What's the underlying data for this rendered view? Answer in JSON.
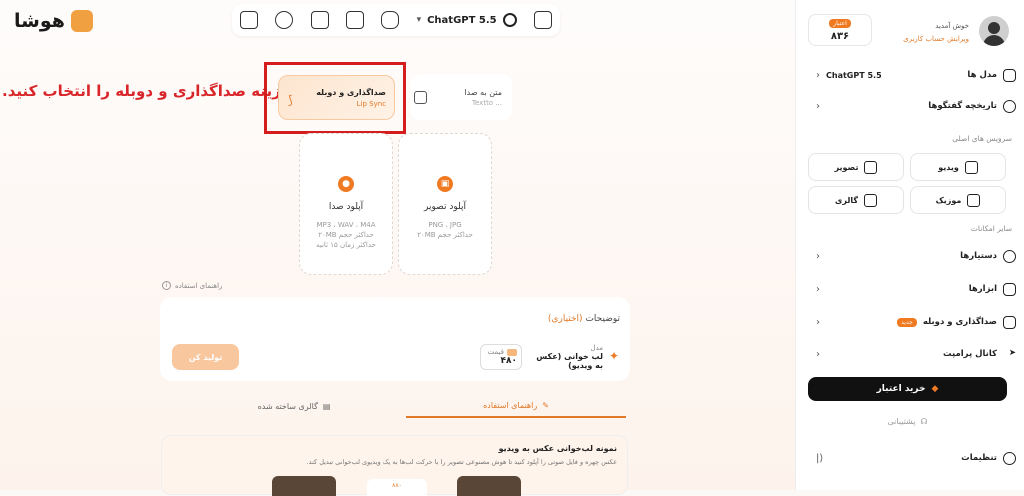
{
  "app": {
    "logo_text": "هوشا"
  },
  "toolbar": {
    "model_name": "ChatGPT 5.5",
    "icons": [
      "home-icon",
      "voice-icon",
      "video-icon",
      "image-icon",
      "robot-icon",
      "chat-icon"
    ]
  },
  "annotation": {
    "instruction": "گزینه صداگذاری و دوبله را انتخاب کنید."
  },
  "mode_cards": {
    "text_to_speech": {
      "title": "متن به صدا",
      "subtitle": "Textto ..."
    },
    "lip_sync": {
      "title": "صداگذاری و دوبله",
      "subtitle": "Lip Sync"
    }
  },
  "uploads": {
    "image": {
      "title": "آپلود تصویر",
      "formats": "PNG ، JPG",
      "limit": "حداکثر حجم ۲۰MB"
    },
    "audio": {
      "title": "آپلود صدا",
      "formats": "MP3 ، WAV ، M4A",
      "limit1": "حداکثر حجم ۲۰MB",
      "limit2": "حداکثر زمان ۱۵ ثانیه"
    }
  },
  "guide_link": "راهنمای استفاده",
  "form": {
    "desc_label": "توضیحات",
    "desc_optional": "(اختیاری)",
    "generate_label": "تولید کن",
    "cost_label": "قیمت",
    "cost_value": "۴۸۰",
    "model_label": "مدل",
    "model_value": "لب خوانی (عکس به ویدیو)"
  },
  "tabs": {
    "guide": "راهنمای استفاده",
    "gallery": "گالری ساخته شده"
  },
  "example": {
    "title": "نمونه لب‌خوانی عکس به ویدیو",
    "desc": "عکس چهره و فایل صوتی را آپلود کنید تا هوش مصنوعی تصویر را با حرکت لب‌ها به یک ویدیوی لب‌خوانی تبدیل کند.",
    "tag": "۸۸۰"
  },
  "sidebar": {
    "greeting": "خوش آمدید",
    "edit_account": "ویرایش حساب کاربری",
    "credit_badge": "اعتبار",
    "credit_value": "۸۳۶",
    "models_label": "مدل ها",
    "models_value": "ChatGPT 5.5",
    "history_label": "تاریخچه گفتگوها",
    "main_services": "سرویس های اصلی",
    "video": "ویدیو",
    "image": "تصویر",
    "music": "موزیک",
    "gallery": "گالری",
    "other_features": "سایر امکانات",
    "assistants": "دستیارها",
    "tools": "ابزارها",
    "dubbing": "صداگذاری و دوبله",
    "new_badge": "جدید",
    "prompt_channel": "کانال پرامپت",
    "buy_credit": "خرید اعتبار",
    "support": "پشتیبانی",
    "settings": "تنظیمات"
  }
}
